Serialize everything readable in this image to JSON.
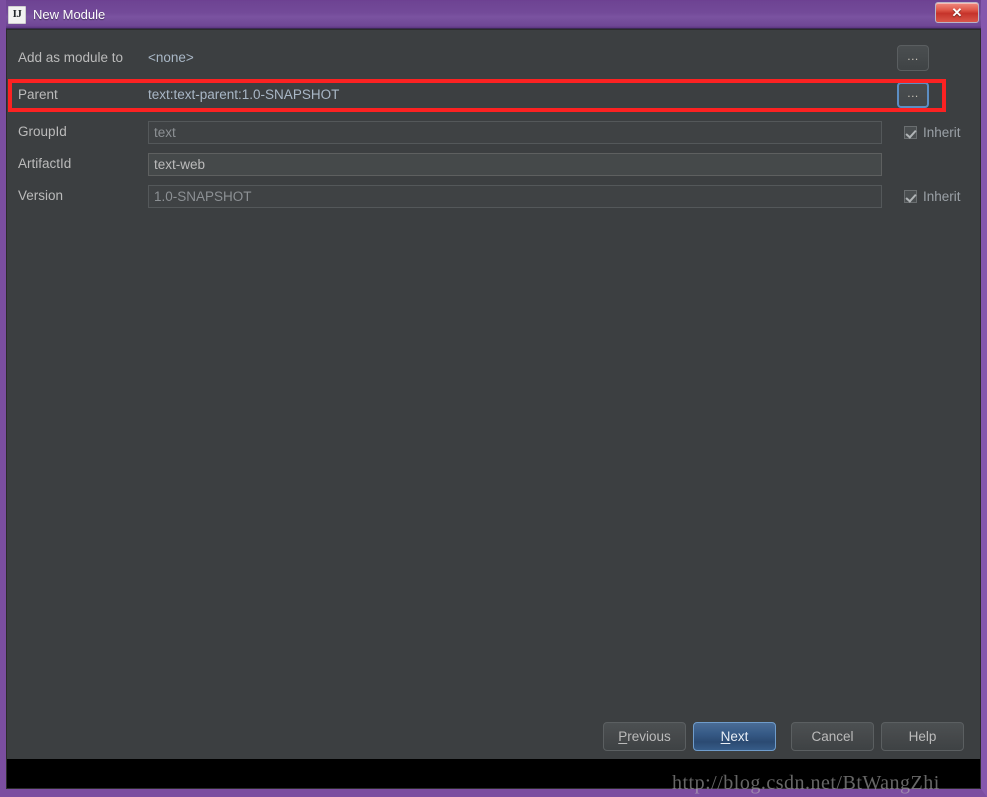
{
  "window": {
    "title": "New Module",
    "app_icon": "IJ",
    "close_icon": "✕",
    "frame_color": "#7b4ea0",
    "titlebar_color": "#734a99",
    "body_color": "#3c3f41"
  },
  "form": {
    "add_as_module": {
      "label": "Add as module to",
      "value": "<none>",
      "chooser_label": "..."
    },
    "parent": {
      "label": "Parent",
      "value": "text:text-parent:1.0-SNAPSHOT",
      "chooser_label": "..."
    },
    "group_id": {
      "label": "GroupId",
      "value": "text",
      "inherit_label": "Inherit",
      "inherit_checked": "✓"
    },
    "artifact_id": {
      "label": "ArtifactId",
      "value": "text-web"
    },
    "version": {
      "label": "Version",
      "value": "1.0-SNAPSHOT",
      "inherit_label": "Inherit",
      "inherit_checked": "✓"
    }
  },
  "annotation": {
    "color": "#fc2222",
    "target": "parent-row"
  },
  "buttons": {
    "previous": {
      "prefix": "",
      "mnemonic": "P",
      "suffix": "revious"
    },
    "next": {
      "prefix": "",
      "mnemonic": "N",
      "suffix": "ext"
    },
    "cancel": {
      "label": "Cancel"
    },
    "help": {
      "label": "Help"
    }
  },
  "watermark": {
    "text": "http://blog.csdn.net/BtWangZhi"
  }
}
